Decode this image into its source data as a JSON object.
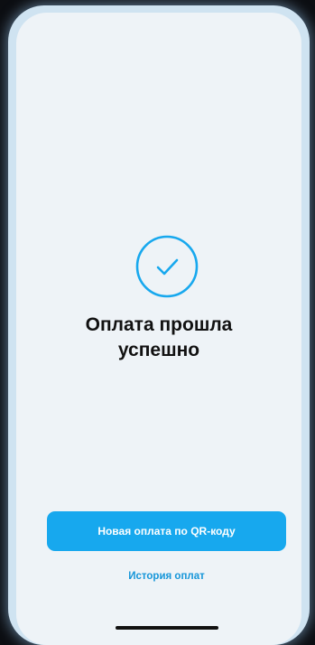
{
  "status": {
    "icon": "check-circle-icon",
    "title_line1": "Оплата прошла",
    "title_line2": "успешно"
  },
  "actions": {
    "new_payment_label": "Новая оплата по QR-коду",
    "history_label": "История оплат"
  },
  "colors": {
    "accent": "#17a8ee",
    "link": "#1696d9",
    "background": "#eef3f7"
  }
}
